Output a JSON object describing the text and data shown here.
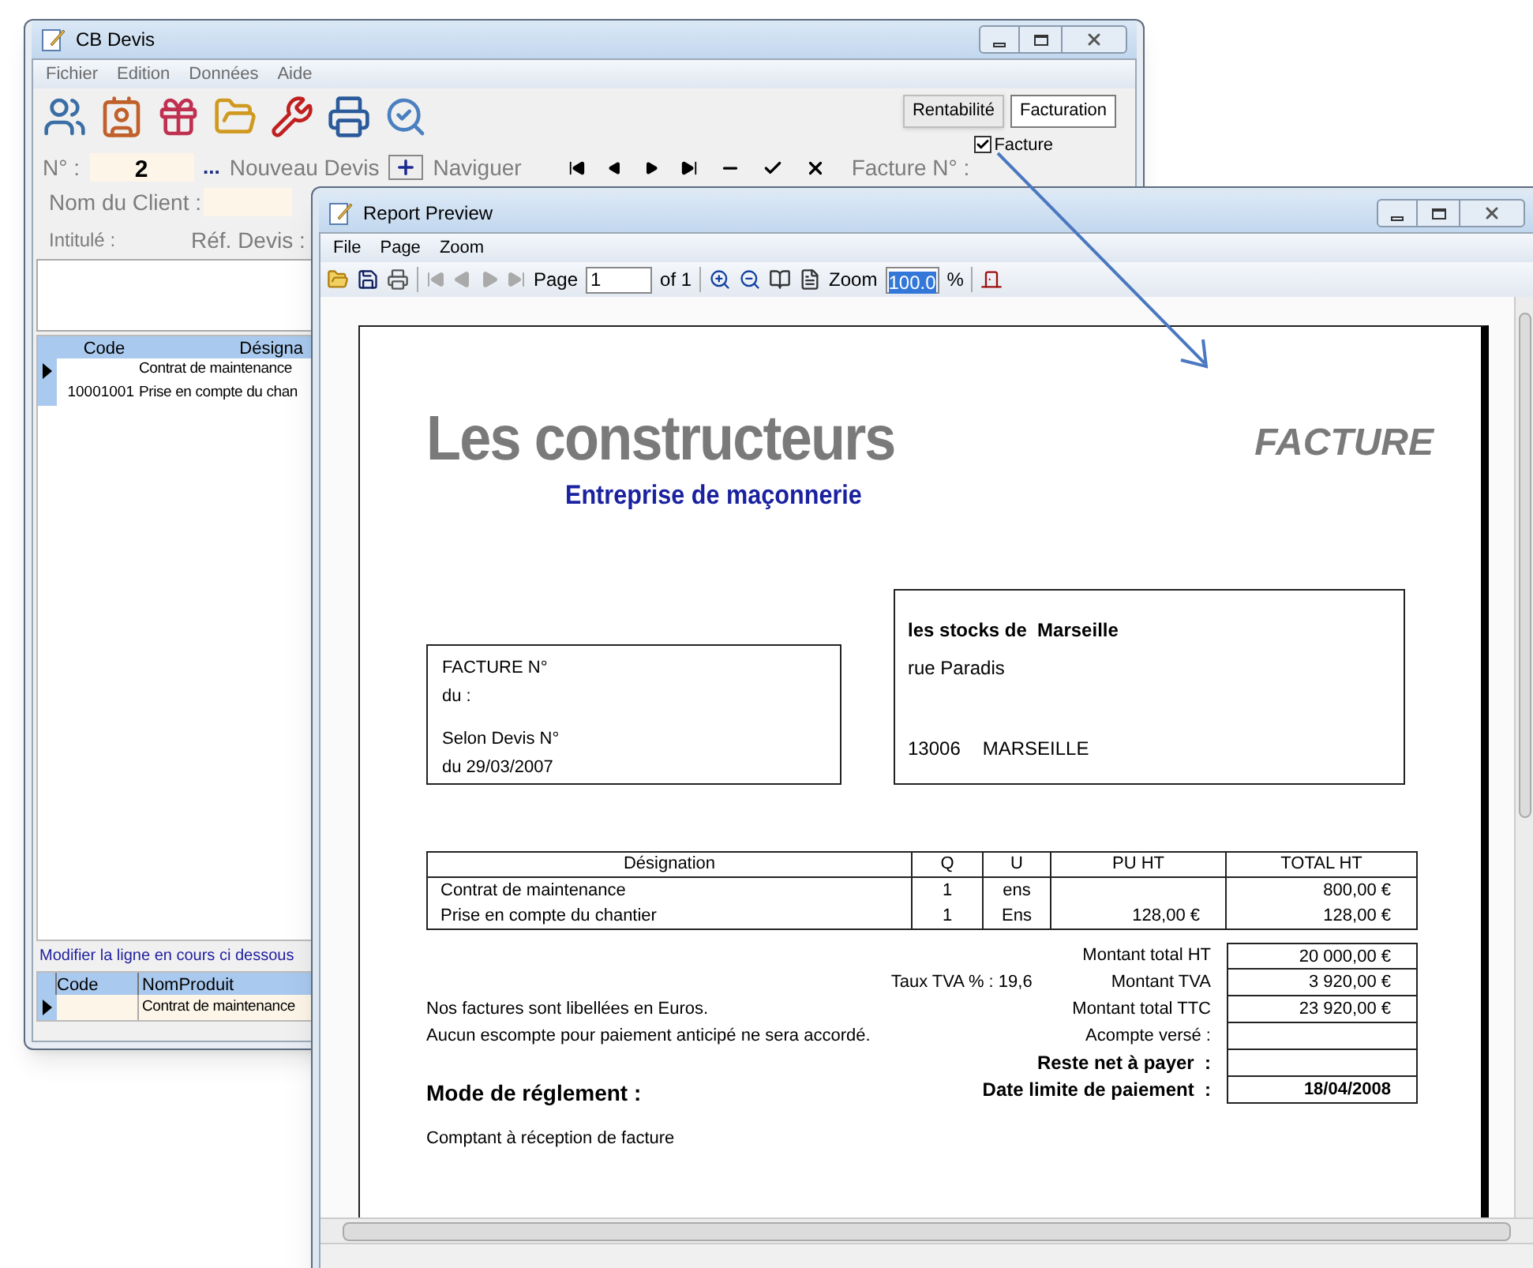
{
  "main_window": {
    "title": "CB Devis",
    "menu": [
      "Fichier",
      "Edition",
      "Données",
      "Aide"
    ],
    "tabs": [
      {
        "label": "Rentabilité",
        "selected": false
      },
      {
        "label": "Facturation",
        "selected": true
      }
    ],
    "facture_checkbox": {
      "label": "Facture",
      "checked": true
    },
    "number_label": "N° :",
    "number_value": "2",
    "more": "...",
    "new_label": "Nouveau Devis",
    "navigate_label": "Naviguer",
    "invoice_label": "Facture N° :",
    "client_label": "Nom du Client :",
    "title_label": "Intitulé :",
    "ref_label": "Réf. Devis :",
    "lines_grid": {
      "columns": [
        "Code",
        "Désigna"
      ],
      "rows": [
        {
          "designation": "Contrat de maintenance",
          "selected": true
        },
        {
          "code": "10001001",
          "designation": "Prise en compte du chan",
          "selected": false
        }
      ]
    },
    "edit_hint": "Modifier la ligne en cours ci dessous",
    "edit_grid": {
      "columns": [
        "Code",
        "NomProduit"
      ],
      "rows": [
        {
          "designation": "Contrat de maintenance",
          "selected": true
        }
      ]
    }
  },
  "report_window": {
    "title": "Report Preview",
    "menu": [
      "File",
      "Page",
      "Zoom"
    ],
    "page_label": "Page",
    "page_value": "1",
    "page_of": "of 1",
    "zoom_label": "Zoom",
    "zoom_value": "100.0",
    "zoom_unit": "%",
    "document": {
      "company": "Les constructeurs",
      "tagline": "Entreprise de maçonnerie",
      "doc_type": "FACTURE",
      "invoice_box": [
        "FACTURE N°",
        "du :",
        "Selon Devis N°",
        "du 29/03/2007"
      ],
      "client": {
        "name": "les stocks de  Marseille",
        "street": "rue Paradis",
        "postcode": "13006",
        "city": "MARSEILLE"
      },
      "table": {
        "columns": [
          "Désignation",
          "Q",
          "U",
          "PU HT",
          "TOTAL HT"
        ],
        "rows": [
          {
            "designation": "Contrat de maintenance",
            "q": "1",
            "u": "ens",
            "total_ht": "800,00 €"
          },
          {
            "designation": "Prise en compte du chantier",
            "q": "1",
            "u": "Ens",
            "pu_ht": "128,00 €",
            "total_ht": "128,00 €"
          }
        ]
      },
      "vat_rate": "Taux TVA % : 19,6",
      "notes": [
        "Nos factures sont libellées en Euros.",
        "Aucun escompte pour paiement anticipé ne sera accordé."
      ],
      "totals": [
        {
          "label": "Montant total HT",
          "value": "20 000,00 €",
          "bold": false
        },
        {
          "label": "Montant TVA",
          "value": "3 920,00 €",
          "bold": false
        },
        {
          "label": "Montant total TTC",
          "value": "23 920,00 €",
          "bold": false
        },
        {
          "label": "Acompte versé :",
          "bold": false
        },
        {
          "label": "Reste net à payer  :",
          "bold": true
        },
        {
          "label": "Date limite de paiement  :",
          "value": "18/04/2008",
          "bold": true
        }
      ],
      "payment_heading": "Mode de réglement :",
      "payment_text": "Comptant à réception de facture"
    }
  }
}
